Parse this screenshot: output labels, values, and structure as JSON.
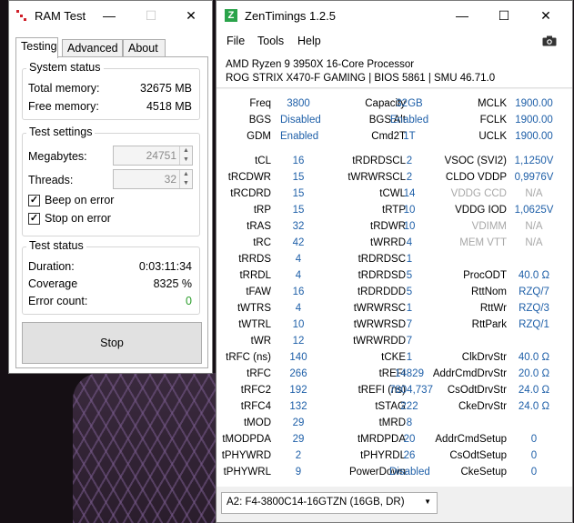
{
  "ram_test": {
    "title": "RAM Test",
    "controls": {
      "minimize": "—",
      "maximize": "☐",
      "close": "✕"
    },
    "tabs": [
      "Testing",
      "Advanced",
      "About"
    ],
    "system_status": {
      "title": "System status",
      "total_memory_label": "Total memory:",
      "total_memory": "32675 MB",
      "free_memory_label": "Free memory:",
      "free_memory": "4518 MB"
    },
    "test_settings": {
      "title": "Test settings",
      "megabytes_label": "Megabytes:",
      "megabytes": "24751",
      "threads_label": "Threads:",
      "threads": "32",
      "beep_label": "Beep on error",
      "beep_checked": true,
      "stop_label": "Stop on error",
      "stop_checked": true
    },
    "test_status": {
      "title": "Test status",
      "duration_label": "Duration:",
      "duration": "0:03:11:34",
      "coverage_label": "Coverage",
      "coverage": "8325 %",
      "errors_label": "Error count:",
      "errors": "0"
    },
    "stop_button": "Stop"
  },
  "zen": {
    "title": "ZenTimings 1.2.5",
    "logo": "Z",
    "controls": {
      "minimize": "—",
      "maximize": "☐",
      "close": "✕"
    },
    "menu": [
      "File",
      "Tools",
      "Help"
    ],
    "cpu": "AMD Ryzen 9 3950X 16-Core Processor",
    "board": "ROG STRIX X470-F GAMING | BIOS 5861 | SMU 46.71.0",
    "top": [
      [
        "Freq",
        "3800",
        "Capacity",
        "32GB",
        "MCLK",
        "1900.00"
      ],
      [
        "BGS",
        "Disabled",
        "BGS Alt",
        "Enabled",
        "FCLK",
        "1900.00"
      ],
      [
        "GDM",
        "Enabled",
        "Cmd2T",
        "1T",
        "UCLK",
        "1900.00"
      ]
    ],
    "timings": [
      [
        "tCL",
        "16",
        "tRDRDSCL",
        "2",
        "VSOC (SVI2)",
        "1,1250V"
      ],
      [
        "tRCDWR",
        "15",
        "tWRWRSCL",
        "2",
        "CLDO VDDP",
        "0,9976V"
      ],
      [
        "tRCDRD",
        "15",
        "tCWL",
        "14",
        "VDDG CCD",
        "N/A"
      ],
      [
        "tRP",
        "15",
        "tRTP",
        "10",
        "VDDG IOD",
        "1,0625V"
      ],
      [
        "tRAS",
        "32",
        "tRDWR",
        "10",
        "VDIMM",
        "N/A"
      ],
      [
        "tRC",
        "42",
        "tWRRD",
        "4",
        "MEM VTT",
        "N/A"
      ],
      [
        "tRRDS",
        "4",
        "tRDRDSC",
        "1",
        "",
        ""
      ],
      [
        "tRRDL",
        "4",
        "tRDRDSD",
        "5",
        "ProcODT",
        "40.0 Ω"
      ],
      [
        "tFAW",
        "16",
        "tRDRDDD",
        "5",
        "RttNom",
        "RZQ/7"
      ],
      [
        "tWTRS",
        "4",
        "tWRWRSC",
        "1",
        "RttWr",
        "RZQ/3"
      ],
      [
        "tWTRL",
        "10",
        "tWRWRSD",
        "7",
        "RttPark",
        "RZQ/1"
      ],
      [
        "tWR",
        "12",
        "tWRWRDD",
        "7",
        "",
        ""
      ],
      [
        "tRFC (ns)",
        "140",
        "tCKE",
        "1",
        "ClkDrvStr",
        "40.0 Ω"
      ],
      [
        "tRFC",
        "266",
        "tREFI",
        "14829",
        "AddrCmdDrvStr",
        "20.0 Ω"
      ],
      [
        "tRFC2",
        "192",
        "tREFI (ns)",
        "7804,737",
        "CsOdtDrvStr",
        "24.0 Ω"
      ],
      [
        "tRFC4",
        "132",
        "tSTAG",
        "222",
        "CkeDrvStr",
        "24.0 Ω"
      ],
      [
        "tMOD",
        "29",
        "tMRD",
        "8",
        "",
        ""
      ],
      [
        "tMODPDA",
        "29",
        "tMRDPDA",
        "20",
        "AddrCmdSetup",
        "0"
      ],
      [
        "tPHYWRD",
        "2",
        "tPHYRDL",
        "26",
        "CsOdtSetup",
        "0"
      ],
      [
        "tPHYWRL",
        "9",
        "PowerDown",
        "Disabled",
        "CkeSetup",
        "0"
      ]
    ],
    "dim_labels": [
      "VDDG CCD",
      "VDIMM",
      "MEM VTT"
    ],
    "module_select": "A2: F4-3800C14-16GTZN (16GB, DR)"
  }
}
